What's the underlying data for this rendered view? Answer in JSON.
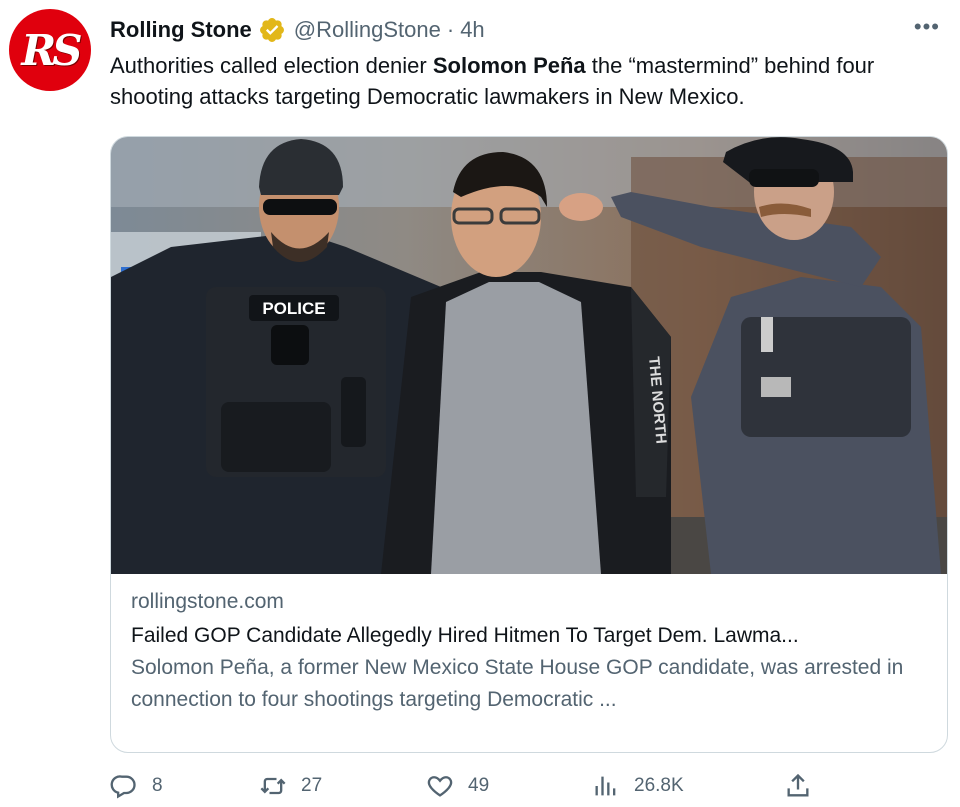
{
  "account": {
    "avatar_text": "RS",
    "display_name": "Rolling Stone",
    "handle": "@RollingStone",
    "separator": "·",
    "time": "4h",
    "more": "•••"
  },
  "tweet": {
    "text_before": "Authorities called election denier ",
    "text_bold": "Solomon Peña",
    "text_after": " the “mastermind” behind four shooting attacks targeting Democratic lawmakers in New Mexico."
  },
  "card": {
    "photo_texts": [
      "POLICE",
      "THE NORTH"
    ],
    "domain": "rollingstone.com",
    "title": "Failed GOP Candidate Allegedly Hired Hitmen To Target Dem. Lawma...",
    "description": "Solomon Peña, a former New Mexico State House GOP candidate, was arrested in connection to four shootings targeting Democratic ..."
  },
  "actions": {
    "replies": "8",
    "retweets": "27",
    "likes": "49",
    "views": "26.8K"
  },
  "icons": {
    "verified": "verified-badge-icon",
    "more": "more-icon",
    "reply": "reply-icon",
    "retweet": "retweet-icon",
    "like": "heart-icon",
    "views": "views-icon",
    "share": "share-icon"
  },
  "colors": {
    "brand_red": "#e0000d",
    "verified_gold": "#e2b719",
    "text_primary": "#0f1419",
    "text_secondary": "#536471",
    "border": "#cfd9de"
  }
}
